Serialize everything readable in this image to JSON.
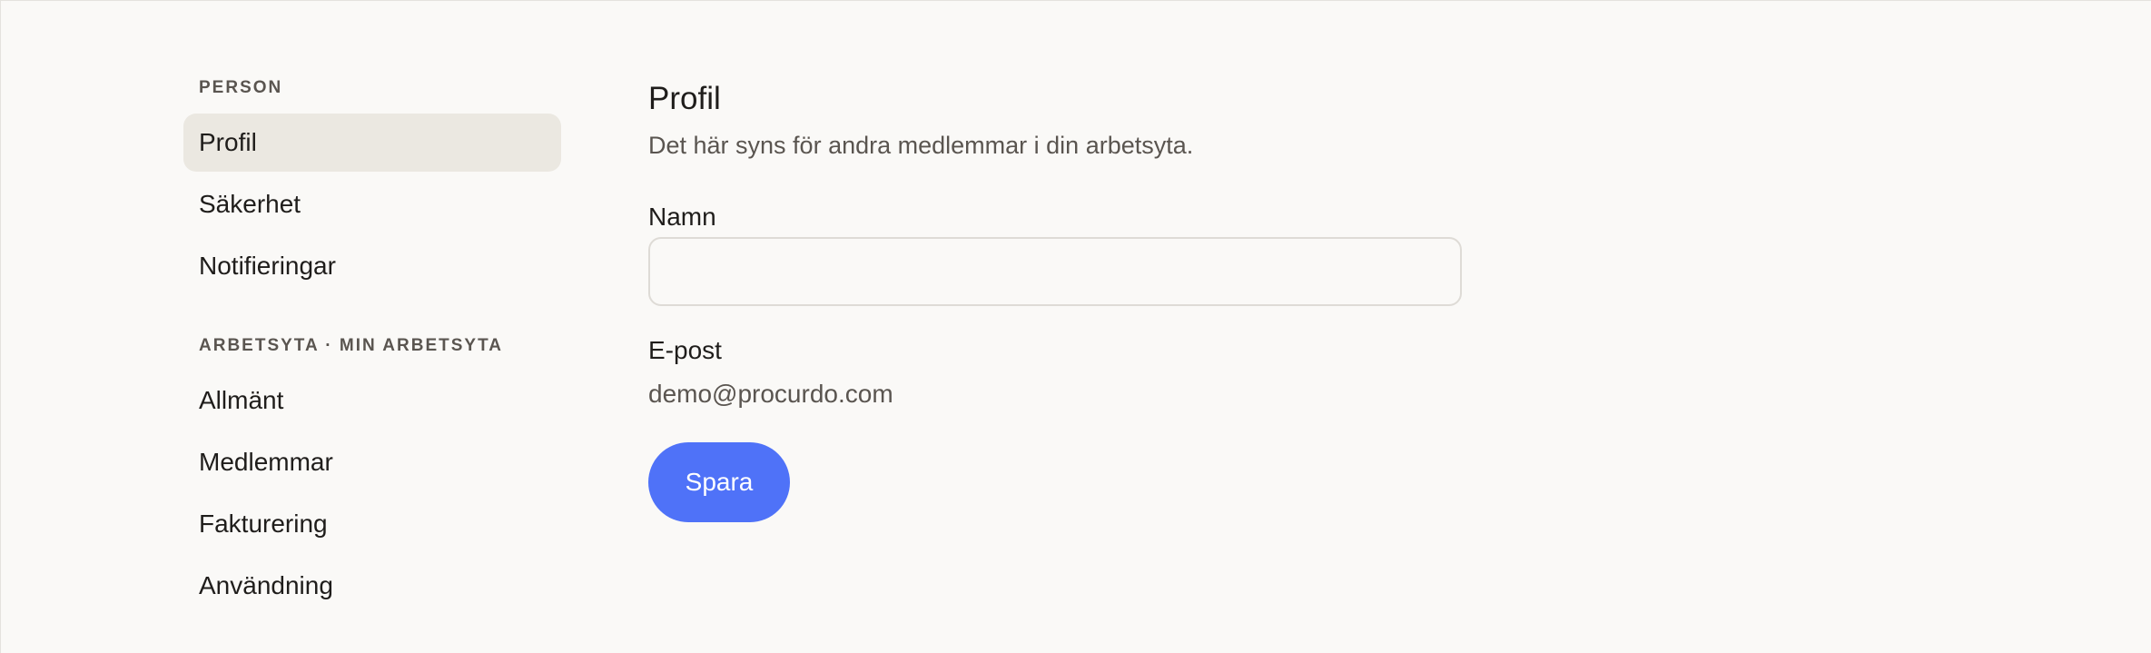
{
  "sidebar": {
    "person_section": {
      "label": "PERSON",
      "items": [
        {
          "label": "Profil",
          "active": true
        },
        {
          "label": "Säkerhet"
        },
        {
          "label": "Notifieringar"
        }
      ]
    },
    "workspace_section": {
      "label": "ARBETSYTA · MIN ARBETSYTA",
      "items": [
        {
          "label": "Allmänt"
        },
        {
          "label": "Medlemmar"
        },
        {
          "label": "Fakturering"
        },
        {
          "label": "Användning"
        }
      ]
    }
  },
  "main": {
    "title": "Profil",
    "subtitle": "Det här syns för andra medlemmar i din arbetsyta.",
    "name_field": {
      "label": "Namn",
      "value": ""
    },
    "email_field": {
      "label": "E-post",
      "value": "demo@procurdo.com"
    },
    "save_label": "Spara"
  },
  "colors": {
    "background": "#faf9f7",
    "active_nav": "#ebe8e1",
    "accent": "#4f72f8",
    "muted_text": "#5a5550"
  }
}
